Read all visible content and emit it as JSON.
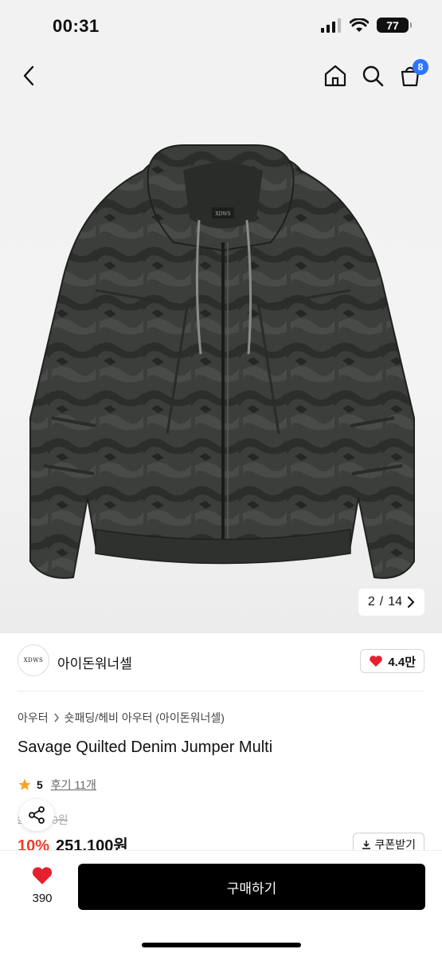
{
  "status": {
    "time": "00:31",
    "battery": "77"
  },
  "product_image": {
    "logo_text": "XDWS",
    "page_current": "2",
    "page_total": "14",
    "page_separator": "/"
  },
  "header": {
    "cart_count": "8"
  },
  "brand": {
    "name": "아이돈워너셀",
    "logo_text": "XDWS",
    "likes": "4.4만"
  },
  "breadcrumb": [
    "아우터",
    "숏패딩/헤비 아우터 (아이돈워너셀)"
  ],
  "product": {
    "title": "Savage Quilted Denim Jumper Multi",
    "rating": "5",
    "review_label": "후기 11개",
    "original_price": "279,000원",
    "discount": "10%",
    "sale_price": "251,100원",
    "coupon_label": "쿠폰받기"
  },
  "footer": {
    "wish_count": "390",
    "buy_label": "구매하기"
  },
  "colors": {
    "accent_red": "#ef3b2d",
    "badge_blue": "#2f74ff",
    "star": "#f5a623",
    "heart": "#e6202f"
  }
}
